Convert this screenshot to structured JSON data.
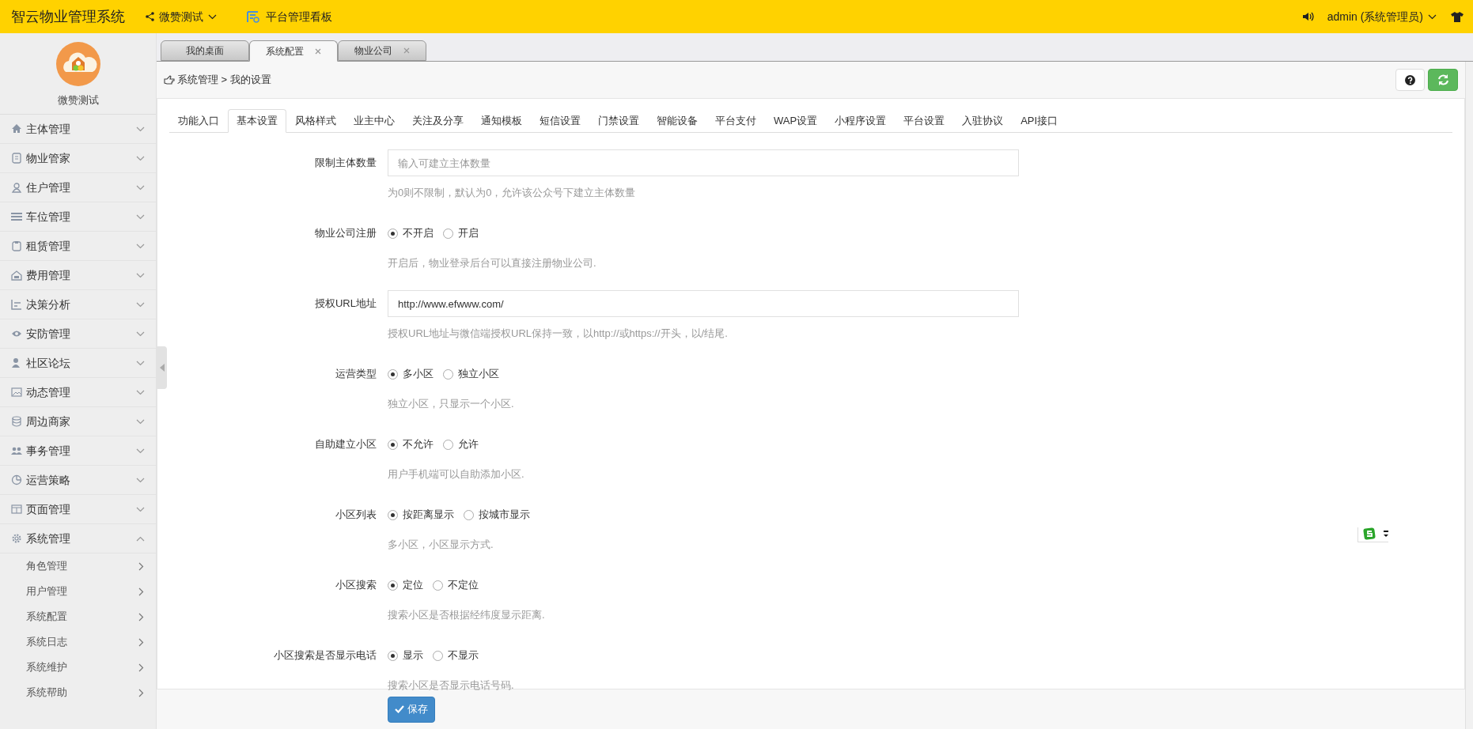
{
  "header": {
    "title": "智云物业管理系统",
    "site": {
      "label": "微赞测试"
    },
    "dashboard": {
      "label": "平台管理看板"
    },
    "user": {
      "label": "admin (系统管理员)"
    }
  },
  "sidebar": {
    "profile": {
      "name": "微赞测试"
    },
    "items": [
      {
        "label": "主体管理",
        "expanded": false
      },
      {
        "label": "物业管家",
        "expanded": false
      },
      {
        "label": "住户管理",
        "expanded": false
      },
      {
        "label": "车位管理",
        "expanded": false
      },
      {
        "label": "租赁管理",
        "expanded": false
      },
      {
        "label": "费用管理",
        "expanded": false
      },
      {
        "label": "决策分析",
        "expanded": false
      },
      {
        "label": "安防管理",
        "expanded": false
      },
      {
        "label": "社区论坛",
        "expanded": false
      },
      {
        "label": "动态管理",
        "expanded": false
      },
      {
        "label": "周边商家",
        "expanded": false
      },
      {
        "label": "事务管理",
        "expanded": false
      },
      {
        "label": "运营策略",
        "expanded": false
      },
      {
        "label": "页面管理",
        "expanded": false
      },
      {
        "label": "系统管理",
        "expanded": true,
        "children": [
          {
            "label": "角色管理"
          },
          {
            "label": "用户管理"
          },
          {
            "label": "系统配置"
          },
          {
            "label": "系统日志"
          },
          {
            "label": "系统维护"
          },
          {
            "label": "系统帮助"
          }
        ]
      }
    ]
  },
  "page_tabs": [
    {
      "label": "我的桌面",
      "selected": false,
      "closable": false
    },
    {
      "label": "系统配置",
      "selected": true,
      "closable": true
    },
    {
      "label": "物业公司",
      "selected": false,
      "closable": true
    }
  ],
  "breadcrumb": "系统管理 > 我的设置",
  "settings_tabs": [
    {
      "label": "功能入口",
      "selected": false
    },
    {
      "label": "基本设置",
      "selected": true
    },
    {
      "label": "风格样式",
      "selected": false
    },
    {
      "label": "业主中心",
      "selected": false
    },
    {
      "label": "关注及分享",
      "selected": false
    },
    {
      "label": "通知模板",
      "selected": false
    },
    {
      "label": "短信设置",
      "selected": false
    },
    {
      "label": "门禁设置",
      "selected": false
    },
    {
      "label": "智能设备",
      "selected": false
    },
    {
      "label": "平台支付",
      "selected": false
    },
    {
      "label": "WAP设置",
      "selected": false
    },
    {
      "label": "小程序设置",
      "selected": false
    },
    {
      "label": "平台设置",
      "selected": false
    },
    {
      "label": "入驻协议",
      "selected": false
    },
    {
      "label": "API接口",
      "selected": false
    }
  ],
  "form": [
    {
      "kind": "input",
      "label": "限制主体数量",
      "placeholder": "输入可建立主体数量",
      "help": "为0则不限制，默认为0，允许该公众号下建立主体数量"
    },
    {
      "kind": "radio",
      "label": "物业公司注册",
      "options": [
        {
          "label": "不开启",
          "selected": true
        },
        {
          "label": "开启",
          "selected": false
        }
      ],
      "help": "开启后，物业登录后台可以直接注册物业公司."
    },
    {
      "kind": "input",
      "label": "授权URL地址",
      "value": "http://www.efwww.com/",
      "help": "授权URL地址与微信端授权URL保持一致，以http://或https://开头，以/结尾."
    },
    {
      "kind": "radio",
      "label": "运营类型",
      "options": [
        {
          "label": "多小区",
          "selected": true
        },
        {
          "label": "独立小区",
          "selected": false
        }
      ],
      "help": "独立小区，只显示一个小区."
    },
    {
      "kind": "radio",
      "label": "自助建立小区",
      "options": [
        {
          "label": "不允许",
          "selected": true
        },
        {
          "label": "允许",
          "selected": false
        }
      ],
      "help": "用户手机端可以自助添加小区."
    },
    {
      "kind": "radio",
      "label": "小区列表",
      "options": [
        {
          "label": "按距离显示",
          "selected": true
        },
        {
          "label": "按城市显示",
          "selected": false
        }
      ],
      "help": "多小区，小区显示方式."
    },
    {
      "kind": "radio",
      "label": "小区搜索",
      "options": [
        {
          "label": "定位",
          "selected": true
        },
        {
          "label": "不定位",
          "selected": false
        }
      ],
      "help": "搜索小区是否根据经纬度显示距离."
    },
    {
      "kind": "radio",
      "label": "小区搜索是否显示电话",
      "options": [
        {
          "label": "显示",
          "selected": true
        },
        {
          "label": "不显示",
          "selected": false
        }
      ],
      "help": "搜索小区是否显示电话号码."
    }
  ],
  "save_button": {
    "label": "保存"
  }
}
